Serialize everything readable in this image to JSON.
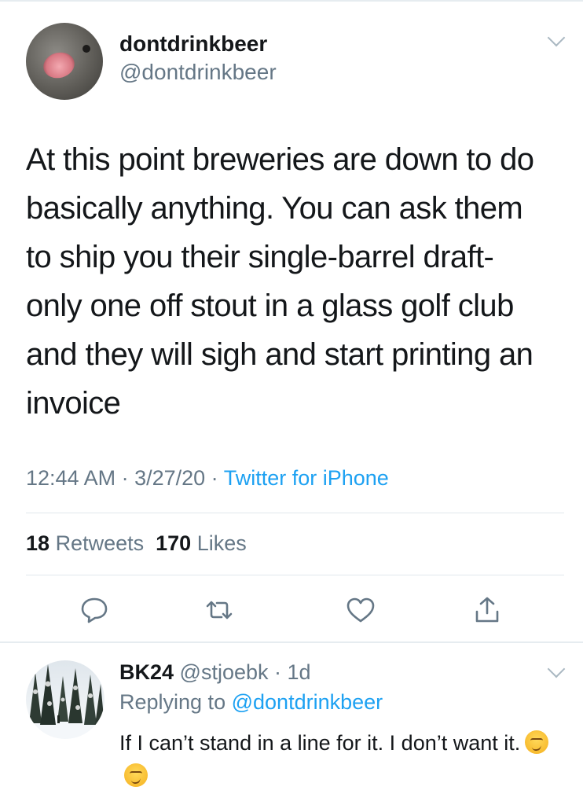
{
  "tweet": {
    "display_name": "dontdrinkbeer",
    "handle": "@dontdrinkbeer",
    "lines": [
      "At this point breweries are down to do",
      "basically anything. You can ask them",
      "to ship you their single-barrel draft-",
      "only one off stout in a glass golf club",
      "and they will sigh and start printing an",
      "invoice"
    ],
    "time": "12:44 AM",
    "date": "3/27/20",
    "separator": " · ",
    "source": "Twitter for iPhone",
    "retweets_count": "18",
    "retweets_label": "Retweets",
    "likes_count": "170",
    "likes_label": "Likes",
    "icons": [
      "reply-icon",
      "retweet-icon",
      "like-icon",
      "share-icon"
    ]
  },
  "reply": {
    "display_name": "BK24",
    "handle": "@stjoebk",
    "age": "1d",
    "replying_prefix": "Replying to",
    "replying_to": "@dontdrinkbeer",
    "text": "If I can’t stand in a line for it. I don’t want it.",
    "emoji": [
      "face-with-raised-eyebrow-emoji",
      "face-with-raised-eyebrow-emoji"
    ]
  },
  "colors": {
    "accent": "#1da1f2",
    "secondary_text": "#657786",
    "primary_text": "#14171a",
    "divider": "#e1e8ed"
  }
}
